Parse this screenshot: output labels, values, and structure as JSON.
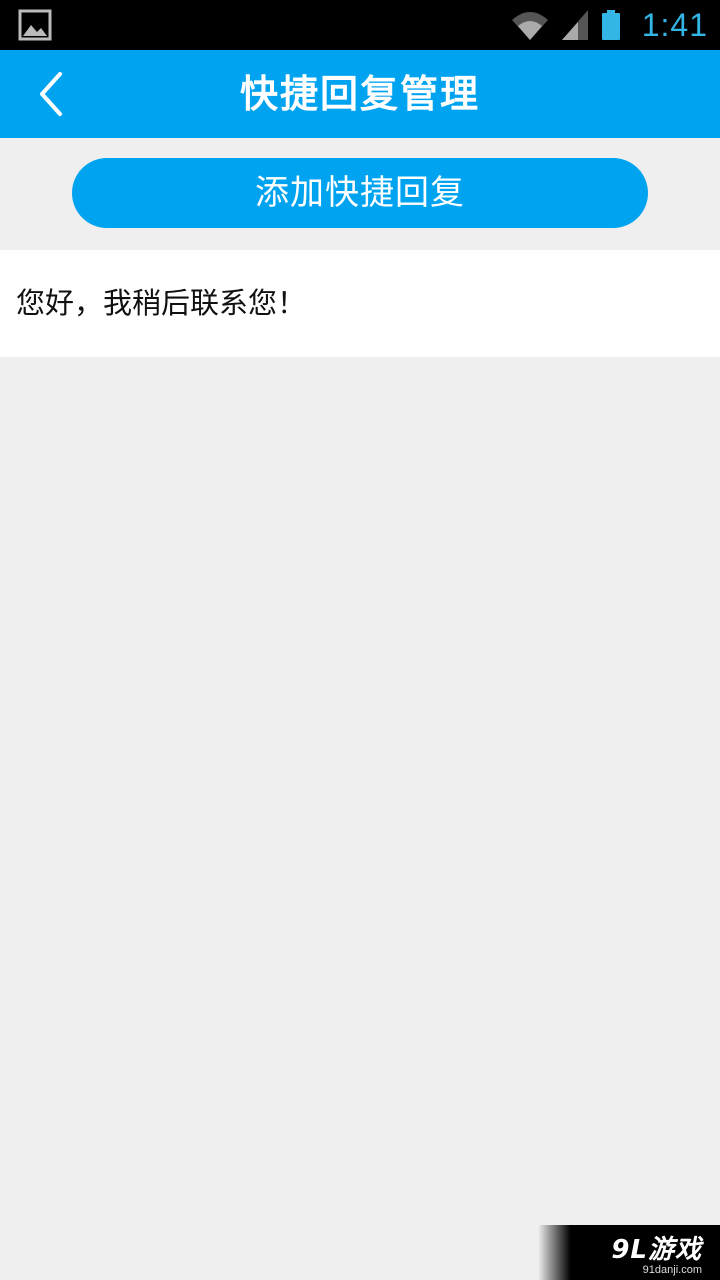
{
  "status_bar": {
    "time": "1:41",
    "icons": [
      "gallery-icon",
      "wifi-icon",
      "signal-icon",
      "battery-icon"
    ],
    "accent_color": "#33b5e5"
  },
  "header": {
    "title": "快捷回复管理",
    "back_icon": "chevron-left-icon",
    "background_color": "#00a3f0"
  },
  "actions": {
    "add_label": "添加快捷回复"
  },
  "replies": [
    {
      "text": "您好，我稍后联系您！"
    }
  ],
  "watermark": {
    "main": "9L游戏",
    "sub": "91danji.com"
  }
}
